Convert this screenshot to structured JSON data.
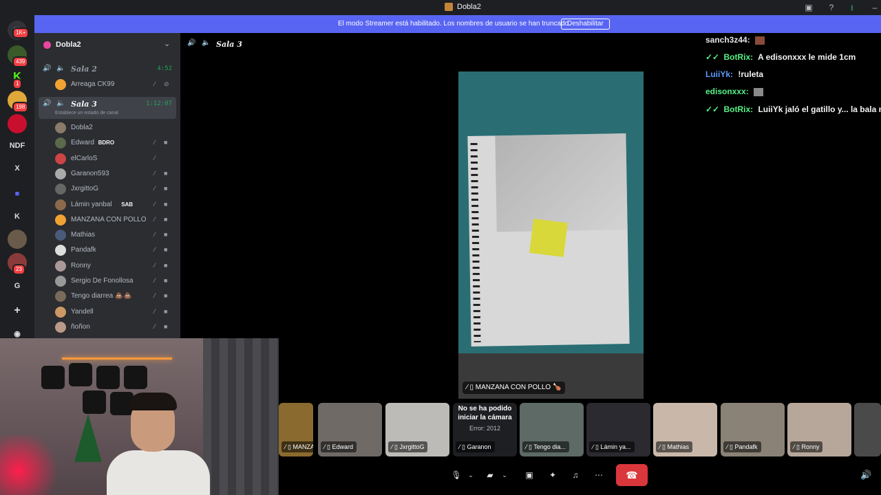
{
  "window": {
    "title": "Dobla2"
  },
  "banner": {
    "text": "El modo Streamer está habilitado. Los nombres de usuario se han truncado.",
    "button": "Deshabilitar"
  },
  "servers": [
    {
      "label": "",
      "badge": "1K+"
    },
    {
      "label": "",
      "badge": "439"
    },
    {
      "label": "K",
      "badge": "1"
    },
    {
      "label": "",
      "badge": "198"
    },
    {
      "label": "",
      "badge": ""
    },
    {
      "label": "NDF",
      "badge": ""
    },
    {
      "label": "X",
      "badge": ""
    },
    {
      "label": "",
      "badge": ""
    },
    {
      "label": "K",
      "badge": ""
    },
    {
      "label": "",
      "badge": ""
    },
    {
      "label": "",
      "badge": "23"
    },
    {
      "label": "G",
      "badge": ""
    },
    {
      "label": "+",
      "badge": ""
    }
  ],
  "guild": {
    "name": "Dobla2"
  },
  "voice_channels": [
    {
      "name": "Sala 2",
      "time": "4:52",
      "status": ""
    },
    {
      "name": "Sala 3",
      "time": "1:12:07",
      "status": "Establece un estado de canal"
    }
  ],
  "sala2_members": [
    {
      "name": "Arreaga CK99",
      "tag": ""
    }
  ],
  "sala3_members": [
    {
      "name": "Dobla2",
      "tag": ""
    },
    {
      "name": "Edward",
      "tag": "BDRO"
    },
    {
      "name": "elCarloS",
      "tag": ""
    },
    {
      "name": "Garanon593",
      "tag": ""
    },
    {
      "name": "JxrgittoG",
      "tag": ""
    },
    {
      "name": "Lámin yanbal",
      "tag": "SAB"
    },
    {
      "name": "MANZANA CON POLLO ...",
      "tag": ""
    },
    {
      "name": "Mathias",
      "tag": ""
    },
    {
      "name": "Pandafk",
      "tag": ""
    },
    {
      "name": "Ronny",
      "tag": ""
    },
    {
      "name": "Sergio De Fonollosa",
      "tag": ""
    },
    {
      "name": "Tengo diarrea 💩💩",
      "tag": ""
    },
    {
      "name": "Yandell",
      "tag": ""
    },
    {
      "name": "ñoñon",
      "tag": ""
    }
  ],
  "stage": {
    "name": "Sala 3"
  },
  "chat": [
    {
      "user": "sanch3z44:",
      "text": "",
      "color": "#e3e5e8",
      "prefix": ""
    },
    {
      "user": "BotRix:",
      "text": "A edisonxxx le mide 1cm",
      "color": "#57f287",
      "prefix": "✓✓"
    },
    {
      "user": "LuiiYk:",
      "text": "!ruleta",
      "color": "#5b9cff",
      "prefix": ""
    },
    {
      "user": "edisonxxx:",
      "text": "",
      "color": "#57f287",
      "prefix": ""
    },
    {
      "user": "BotRix:",
      "text": "LuiiYk jaló el gatillo y... la bala no",
      "color": "#57f287",
      "prefix": "✓✓"
    }
  ],
  "main_video": {
    "label": "MANZANA CON POLLO 🍗"
  },
  "tiles": [
    {
      "label": "MANZAN...",
      "error_title": "",
      "error_sub": "",
      "color": "#8a6a2f"
    },
    {
      "label": "Edward",
      "error_title": "",
      "error_sub": "",
      "color": "#6f6a66"
    },
    {
      "label": "JxrgittoG",
      "error_title": "",
      "error_sub": "",
      "color": "#bdbbb8"
    },
    {
      "label": "Garanon",
      "error_title": "No se ha podido iniciar la cámara",
      "error_sub": "Error: 2012",
      "color": "#1e1f22"
    },
    {
      "label": "Tengo dia...",
      "error_title": "",
      "error_sub": "",
      "color": "#5d6a66"
    },
    {
      "label": "Lámin ya...",
      "error_title": "",
      "error_sub": "",
      "color": "#2a2a30"
    },
    {
      "label": "Mathias",
      "error_title": "",
      "error_sub": "",
      "color": "#c9b8aa"
    },
    {
      "label": "Pandafk",
      "error_title": "",
      "error_sub": "",
      "color": "#8a8276"
    },
    {
      "label": "Ronny",
      "error_title": "",
      "error_sub": "",
      "color": "#b7a79a"
    },
    {
      "label": "",
      "error_title": "",
      "error_sub": "",
      "color": "#4a4a4a"
    }
  ]
}
